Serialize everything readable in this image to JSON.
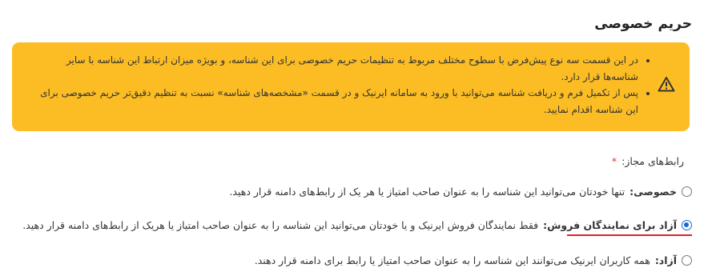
{
  "page": {
    "title": "حریم خصوصی"
  },
  "notice": {
    "icon": "warning-icon",
    "background": "#fbbd23",
    "items": [
      "در این قسمت سه نوع پیش‌فرض با سطوح مختلف مربوط به تنظیمات حریم خصوصی برای این شناسه، و بویژه میزان ارتباط این شناسه با سایر شناسه‌ها قرار دارد.",
      "پس از تکمیل فرم و دریافت شناسه می‌توانید با ورود به سامانه ایرنیک و در قسمت «مشخصه‌های شناسه» نسبت به تنظیم دقیق‌تر حریم خصوصی برای این شناسه اقدام نمایید."
    ]
  },
  "allowed_links": {
    "label": "رابط‌های مجاز:",
    "required_mark": "*",
    "selected": "reseller",
    "options": [
      {
        "id": "private",
        "title": "خصوصی:",
        "description": "تنها خودتان می‌توانید این شناسه را به عنوان صاحب امتیاز یا هر یک از رابط‌های دامنه قرار دهید."
      },
      {
        "id": "reseller",
        "title": "آزاد برای نمایندگان فروش:",
        "description": "فقط نمایندگان فروش ایرنیک و یا خودتان می‌توانید این شناسه را به عنوان صاحب امتیاز یا هریک از رابط‌های دامنه قرار دهید."
      },
      {
        "id": "public",
        "title": "آزاد:",
        "description": "همه کاربران ایرنیک می‌توانند این شناسه را به عنوان صاحب امتیاز یا رابط برای دامنه قرار دهند."
      }
    ]
  }
}
